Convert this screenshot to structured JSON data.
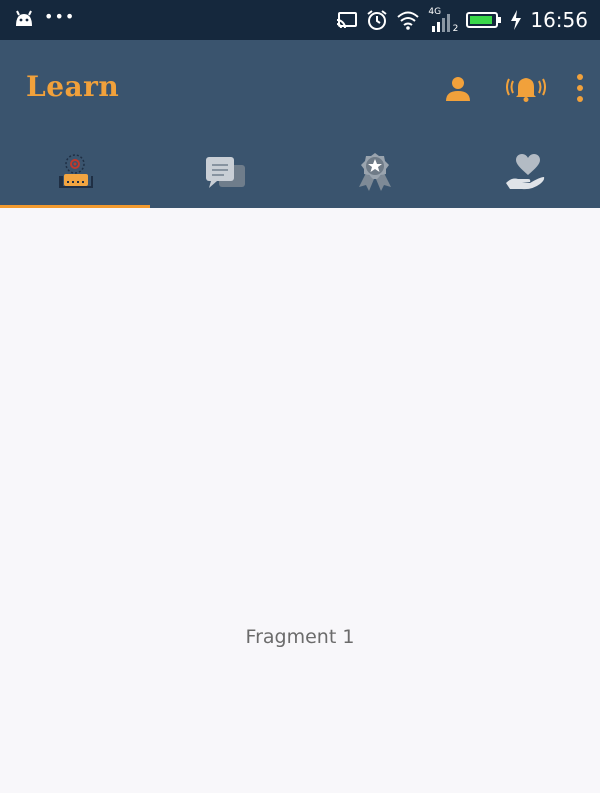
{
  "status_bar": {
    "time": "16:56",
    "network_label": "4G",
    "sim_label": "2",
    "icons": [
      "android-icon",
      "more-dots-icon",
      "cast-icon",
      "alarm-icon",
      "wifi-icon",
      "signal-icon",
      "battery-icon",
      "charging-icon"
    ]
  },
  "app_bar": {
    "title": "Learn",
    "title_color": "#f1a13b",
    "background": "#3a546e",
    "actions": [
      "profile-icon",
      "notification-bell-icon",
      "overflow-menu-icon"
    ]
  },
  "tabs": [
    {
      "icon": "learn-tab-icon",
      "selected": true
    },
    {
      "icon": "chat-tab-icon",
      "selected": false
    },
    {
      "icon": "award-tab-icon",
      "selected": false
    },
    {
      "icon": "care-tab-icon",
      "selected": false
    }
  ],
  "tab_indicator_color": "#f29a2e",
  "content": {
    "label": "Fragment 1"
  }
}
